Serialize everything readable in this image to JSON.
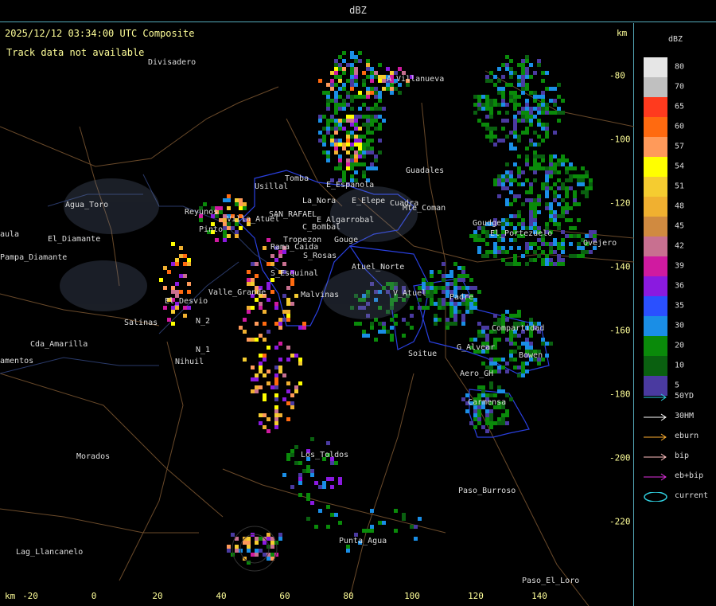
{
  "header": {
    "title": "dBZ"
  },
  "map": {
    "timestamp": "2025/12/12 03:34:00 UTC Composite",
    "status": "Track data not available",
    "km_top": "km",
    "km_bottom": "km",
    "x_ticks": [
      "-20",
      "0",
      "20",
      "40",
      "60",
      "80",
      "100",
      "120",
      "140"
    ],
    "y_ticks": [
      "-80",
      "-100",
      "-120",
      "-140",
      "-160",
      "-180",
      "-200",
      "-220"
    ],
    "places": [
      "Divisadero",
      "A_Villanueva",
      "Guadales",
      "Tomba",
      "E_Espanola",
      "Usillal",
      "La_Nora",
      "E_Elepe",
      "Cuadra",
      "Rama_Caida",
      "Villa_Atuel",
      "SAN_RAFAEL",
      "E_Algarrobal",
      "C_Bombal",
      "Reyunos",
      "Pinto",
      "Tropezon",
      "Gouge",
      "Los_Toldos",
      "Agua_Toro",
      "El_Diamante",
      "Pampa_Diamante",
      "Cda_Amarilla",
      "El_Desvio",
      "Salinas",
      "N_1",
      "N_2",
      "Nihuil",
      "Valle_Grande",
      "S_Rosas",
      "Atuel_Norte",
      "Malvinas",
      "V_Atuel",
      "Soitue",
      "G_Alvear",
      "Padre",
      "Compartidad",
      "Bowen",
      "Aero_GH",
      "Carmensa",
      "Morados",
      "Paso_Burroso",
      "Punta_Agua",
      "Lag_Llancanelo",
      "Paso_El_Loro",
      "Ovejero",
      "Goudge",
      "S_Esquinal",
      "Mte_Coman",
      "El_Portezuelo",
      "amentos",
      "aula"
    ]
  },
  "legend": {
    "title": "dBZ",
    "levels": [
      {
        "value": "80",
        "color": "#e6e6e6"
      },
      {
        "value": "70",
        "color": "#c0c0c0"
      },
      {
        "value": "65",
        "color": "#ff3a1e"
      },
      {
        "value": "60",
        "color": "#ff6a10"
      },
      {
        "value": "57",
        "color": "#ff9a5a"
      },
      {
        "value": "54",
        "color": "#ffff00"
      },
      {
        "value": "51",
        "color": "#f5cc30"
      },
      {
        "value": "48",
        "color": "#f0b030"
      },
      {
        "value": "45",
        "color": "#d08a40"
      },
      {
        "value": "42",
        "color": "#c87090"
      },
      {
        "value": "39",
        "color": "#d01aa0"
      },
      {
        "value": "36",
        "color": "#8a1ae0"
      },
      {
        "value": "35",
        "color": "#2a50ff"
      },
      {
        "value": "30",
        "color": "#1a8ee6"
      },
      {
        "value": "20",
        "color": "#0a8a0a"
      },
      {
        "value": "10",
        "color": "#0a6010"
      },
      {
        "value": "5",
        "color": "#4a3aa0"
      }
    ],
    "tracks": [
      {
        "label": "50YD",
        "color": "#30d0e0"
      },
      {
        "label": "30HM",
        "color": "#ffffff"
      },
      {
        "label": "eburn",
        "color": "#ffb030"
      },
      {
        "label": "bip",
        "color": "#ffc0c0"
      },
      {
        "label": "eb+bip",
        "color": "#e030e0"
      },
      {
        "label": "current",
        "color": "#30d0e0"
      }
    ]
  }
}
